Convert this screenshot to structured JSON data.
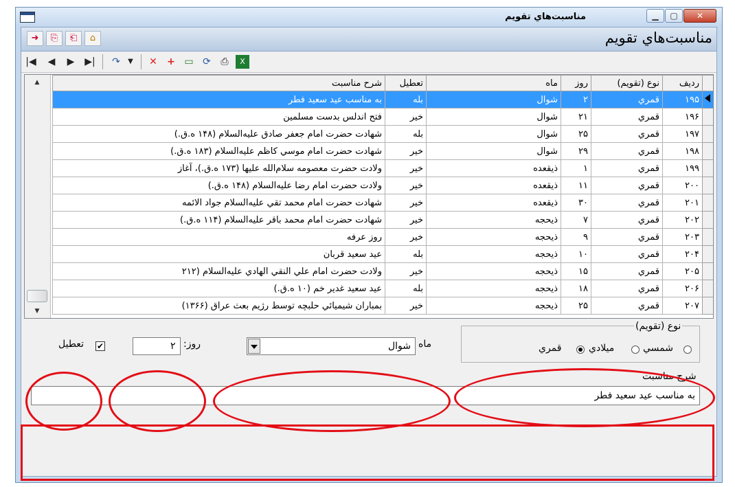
{
  "window": {
    "title": "مناسبت‌هاي تقويم",
    "header_title": "مناسبت‌هاي تقويم"
  },
  "grid": {
    "columns": {
      "radif": "رديف",
      "type": "نوع (تقويم)",
      "day": "روز",
      "month": "ماه",
      "holiday": "تعطيل",
      "desc": "شرح مناسبت"
    },
    "rows": [
      {
        "radif": "۱۹۵",
        "type": "قمري",
        "day": "۲",
        "month": "شوال",
        "holiday": "بله",
        "desc": "به مناسب عيد سعيد فطر"
      },
      {
        "radif": "۱۹۶",
        "type": "قمري",
        "day": "۲۱",
        "month": "شوال",
        "holiday": "خير",
        "desc": "فتح اندلس بدست مسلمين"
      },
      {
        "radif": "۱۹۷",
        "type": "قمري",
        "day": "۲۵",
        "month": "شوال",
        "holiday": "بله",
        "desc": "شهادت حضرت امام جعفر صادق عليه‌السلام (۱۴۸ ه.ق.)"
      },
      {
        "radif": "۱۹۸",
        "type": "قمري",
        "day": "۲۹",
        "month": "شوال",
        "holiday": "خير",
        "desc": "شهادت حضرت امام موسي كاظم عليه‌السلام (۱۸۳ ه.ق.)"
      },
      {
        "radif": "۱۹۹",
        "type": "قمري",
        "day": "۱",
        "month": "ذيقعده",
        "holiday": "خير",
        "desc": "ولادت حضرت معصومه سلام‌الله عليها (۱۷۳ ه.ق.)، آغاز"
      },
      {
        "radif": "۲۰۰",
        "type": "قمري",
        "day": "۱۱",
        "month": "ذيقعده",
        "holiday": "خير",
        "desc": "ولادت حضرت امام رضا عليه‌السلام (۱۴۸ ه.ق.)"
      },
      {
        "radif": "۲۰۱",
        "type": "قمري",
        "day": "۳۰",
        "month": "ذيقعده",
        "holiday": "خير",
        "desc": "شهادت حضرت امام محمد تقي عليه‌السلام جواد الائمه"
      },
      {
        "radif": "۲۰۲",
        "type": "قمري",
        "day": "۷",
        "month": "ذيحجه",
        "holiday": "خير",
        "desc": "شهادت حضرت امام محمد باقر عليه‌السلام (۱۱۴ ه.ق.)"
      },
      {
        "radif": "۲۰۳",
        "type": "قمري",
        "day": "۹",
        "month": "ذيحجه",
        "holiday": "خير",
        "desc": "روز عرفه"
      },
      {
        "radif": "۲۰۴",
        "type": "قمري",
        "day": "۱۰",
        "month": "ذيحجه",
        "holiday": "بله",
        "desc": "عيد سعيد قربان"
      },
      {
        "radif": "۲۰۵",
        "type": "قمري",
        "day": "۱۵",
        "month": "ذيحجه",
        "holiday": "خير",
        "desc": "ولادت حضرت امام علي النقي الهادي عليه‌السلام (۲۱۲"
      },
      {
        "radif": "۲۰۶",
        "type": "قمري",
        "day": "۱۸",
        "month": "ذيحجه",
        "holiday": "بله",
        "desc": "عيد سعيد غدير خم (۱۰ ه.ق.)"
      },
      {
        "radif": "۲۰۷",
        "type": "قمري",
        "day": "۲۵",
        "month": "ذيحجه",
        "holiday": "خير",
        "desc": "بمباران شيميائي حلبچه توسط رژيم بعث عراق (۱۳۶۶)"
      }
    ]
  },
  "form": {
    "type_group_label": "نوع (تقويم)",
    "type_options": [
      "شمسي",
      "ميلادي",
      "قمري"
    ],
    "type_selected": "قمري",
    "month_label": "ماه",
    "month_value": "شوال",
    "day_label": "روز:",
    "day_value": "۲",
    "holiday_label": "تعطيل",
    "holiday_checked": true,
    "desc_label": "شرح مناسبت",
    "desc_value": "به مناسب عيد سعيد فطر"
  },
  "colors": {
    "selection": "#3399ff",
    "annotation": "#e30d16"
  }
}
